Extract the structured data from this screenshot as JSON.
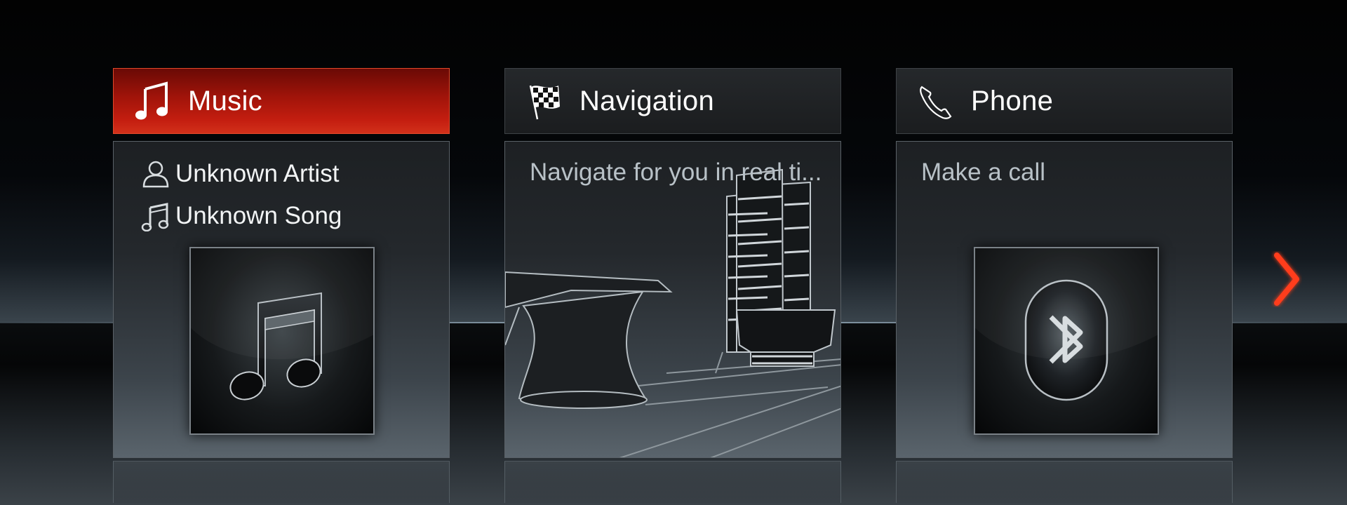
{
  "cards": [
    {
      "title": "Music",
      "icon": "music-note-icon",
      "active": true,
      "artist": "Unknown Artist",
      "song": "Unknown Song",
      "tile_icon": "music-note-icon"
    },
    {
      "title": "Navigation",
      "icon": "checkered-flag-icon",
      "active": false,
      "subtitle": "Navigate for you in real ti..."
    },
    {
      "title": "Phone",
      "icon": "phone-handset-icon",
      "active": false,
      "subtitle": "Make a call",
      "tile_icon": "bluetooth-icon"
    }
  ],
  "next_arrow": "chevron-right-icon",
  "colors": {
    "active_header": "#b8180c",
    "arrow": "#ff3c1a"
  }
}
